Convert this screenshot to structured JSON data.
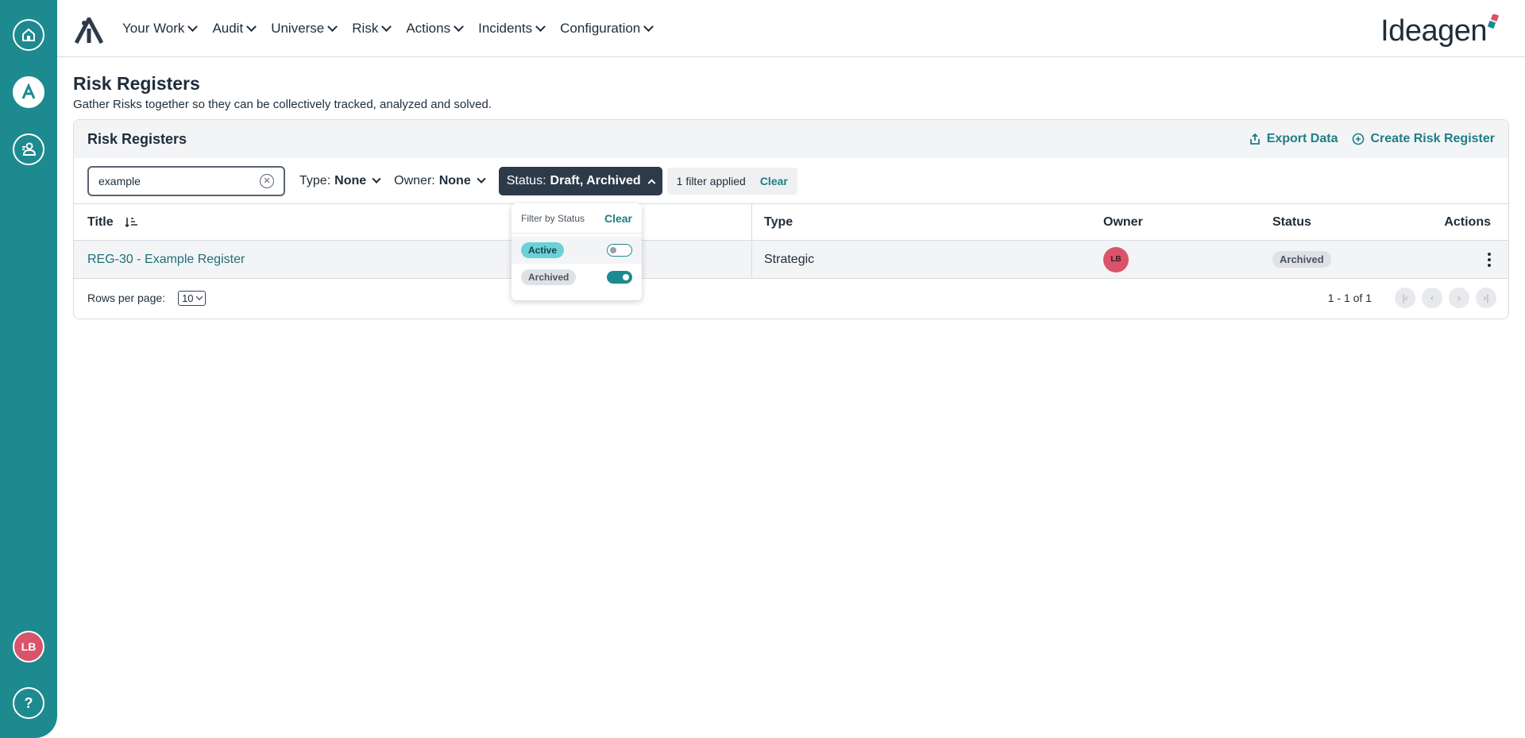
{
  "nav": {
    "items": [
      {
        "label": "Your Work"
      },
      {
        "label": "Audit"
      },
      {
        "label": "Universe"
      },
      {
        "label": "Risk"
      },
      {
        "label": "Actions"
      },
      {
        "label": "Incidents"
      },
      {
        "label": "Configuration"
      }
    ],
    "brand": "Ideagen"
  },
  "rail": {
    "avatar_initials": "LB",
    "help_label": "?"
  },
  "page": {
    "title": "Risk Registers",
    "subtitle": "Gather Risks together so they can be collectively tracked, analyzed and solved."
  },
  "card": {
    "title": "Risk Registers",
    "export_label": "Export Data",
    "create_label": "Create Risk Register"
  },
  "filters": {
    "search_value": "example",
    "type_label": "Type:",
    "type_value": "None",
    "owner_label": "Owner:",
    "owner_value": "None",
    "status_label": "Status:",
    "status_value": "Draft, Archived",
    "applied_text": "1 filter applied",
    "clear_label": "Clear"
  },
  "status_popover": {
    "heading": "Filter by Status",
    "clear_label": "Clear",
    "options": [
      {
        "label": "Active",
        "on": false
      },
      {
        "label": "Archived",
        "on": true
      }
    ]
  },
  "table": {
    "headers": {
      "title": "Title",
      "type": "Type",
      "owner": "Owner",
      "status": "Status",
      "actions": "Actions"
    },
    "rows": [
      {
        "title": "REG-30 - Example Register",
        "type": "Strategic",
        "owner_initials": "LB",
        "status": "Archived"
      }
    ]
  },
  "pagination": {
    "rows_per_page_label": "Rows per page:",
    "rows_per_page_value": "10",
    "range_text": "1 - 1 of 1"
  },
  "colors": {
    "accent": "#1d8a8f",
    "link": "#1d7f84",
    "avatar": "#d9546b",
    "dark": "#2c3a4a"
  }
}
